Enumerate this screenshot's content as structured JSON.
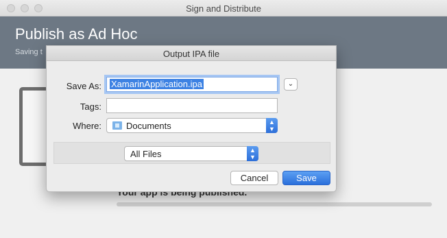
{
  "window": {
    "title": "Sign and Distribute"
  },
  "banner": {
    "title": "Publish as Ad Hoc",
    "subtitle": "Saving t"
  },
  "progress": {
    "label": "Your app is being published.",
    "value": 0.0
  },
  "dialog": {
    "title": "Output IPA file",
    "save_as_label": "Save As:",
    "save_as_value": "XamarinApplication.ipa",
    "tags_label": "Tags:",
    "tags_value": "",
    "where_label": "Where:",
    "where_value": "Documents",
    "where_icon": "folder-icon",
    "file_type_value": "All Files",
    "cancel_label": "Cancel",
    "save_label": "Save",
    "accent_color": "#3d82e3"
  }
}
